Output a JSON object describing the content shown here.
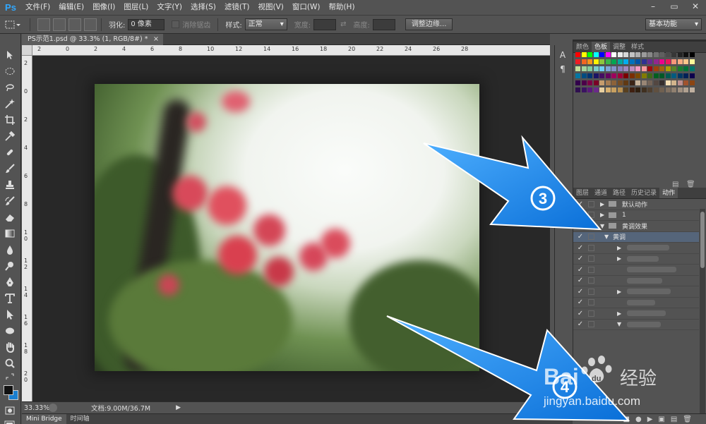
{
  "app": {
    "logo": "Ps"
  },
  "menu": [
    "文件(F)",
    "编辑(E)",
    "图像(I)",
    "图层(L)",
    "文字(Y)",
    "选择(S)",
    "滤镜(T)",
    "视图(V)",
    "窗口(W)",
    "帮助(H)"
  ],
  "window_controls": {
    "minimize": "–",
    "restore": "▭",
    "close": "✕"
  },
  "options": {
    "feather_label": "羽化:",
    "feather_value": "0 像素",
    "antialias_label": "消除锯齿",
    "style_label": "样式:",
    "style_value": "正常",
    "width_label": "宽度:",
    "height_label": "高度:",
    "refine_button": "调整边缘...",
    "workspace": "基本功能"
  },
  "document": {
    "tab_title": "PS示范1.psd @ 33.3% (1, RGB/8#) *",
    "close": "×"
  },
  "ruler": {
    "h_labels": [
      "2",
      "0",
      "2",
      "4",
      "6",
      "8",
      "10",
      "12",
      "14",
      "16",
      "18",
      "20",
      "22",
      "24",
      "26",
      "28"
    ],
    "v_labels": [
      "2",
      "0",
      "2",
      "4",
      "6",
      "8",
      "1 0",
      "1 2",
      "1 4",
      "1 6",
      "1 8",
      "2 0"
    ]
  },
  "status": {
    "zoom": "33.33%",
    "doc_size": "文档:9.00M/36.7M"
  },
  "bottom_tabs": [
    "Mini Bridge",
    "时间轴"
  ],
  "swatches_panel": {
    "tabs": [
      "颜色",
      "色板",
      "调整",
      "样式"
    ],
    "active": 1
  },
  "swatch_colors": [
    [
      "#ff0000",
      "#ffff00",
      "#00ff00",
      "#00ffff",
      "#0000ff",
      "#ff00ff",
      "#ffffff",
      "#ebebeb",
      "#d7d7d7",
      "#c3c3c3",
      "#afafaf",
      "#9b9b9b",
      "#878787",
      "#737373",
      "#5f5f5f",
      "#4b4b4b",
      "#373737",
      "#232323",
      "#0f0f0f",
      "#000000"
    ],
    [
      "#ee1c24",
      "#f26522",
      "#f7941d",
      "#fff200",
      "#8dc63f",
      "#39b54a",
      "#00a651",
      "#00a99d",
      "#00aeef",
      "#0072bc",
      "#0054a6",
      "#2e3192",
      "#662d91",
      "#92278f",
      "#ec008c",
      "#ed145b",
      "#f7977a",
      "#f9ad81",
      "#fdc68a",
      "#fff79a"
    ],
    [
      "#c4df9b",
      "#a3d39c",
      "#82ca9c",
      "#7accc8",
      "#6dcff6",
      "#7da7d9",
      "#8393ca",
      "#8781bd",
      "#a187be",
      "#bd8cbf",
      "#f49ac2",
      "#f6989d",
      "#9e0b0f",
      "#a0410d",
      "#a36209",
      "#aba000",
      "#598527",
      "#197b30",
      "#007236",
      "#00746b"
    ],
    [
      "#0076a3",
      "#004b80",
      "#003471",
      "#1b1464",
      "#440e62",
      "#630460",
      "#9e005d",
      "#9e0039",
      "#790000",
      "#7b2e00",
      "#7d4900",
      "#827b00",
      "#406618",
      "#005e20",
      "#005826",
      "#005952",
      "#005b7f",
      "#003663",
      "#002157",
      "#0d004c"
    ],
    [
      "#32004b",
      "#4b0049",
      "#7b0046",
      "#7a0026",
      "#c69c6d",
      "#a67c52",
      "#8c6239",
      "#754c24",
      "#603913",
      "#3c2415",
      "#c7b299",
      "#998675",
      "#736357",
      "#534741",
      "#362f2d",
      "#f5deb3",
      "#d2b48c",
      "#bc8f8f",
      "#a0522d",
      "#8b4513"
    ],
    [
      "#2f0f4f",
      "#3b1361",
      "#5a1a7a",
      "#6b2a8a",
      "#e8d0a0",
      "#d8b070",
      "#c8a060",
      "#b89050",
      "#584020",
      "#402010",
      "#302010",
      "#403020",
      "#504030",
      "#605040",
      "#706050",
      "#807060",
      "#908070",
      "#a09080",
      "#b0a090",
      "#c0b0a0"
    ]
  ],
  "actions_panel": {
    "tabs": [
      "图层",
      "通道",
      "路径",
      "历史记录",
      "动作"
    ],
    "active": 4,
    "rows": [
      {
        "check": "✓",
        "tri": "▶",
        "folder": true,
        "label": "默认动作",
        "selected": false
      },
      {
        "check": "✓",
        "tri": "▶",
        "folder": true,
        "label": "1",
        "selected": false
      },
      {
        "check": "✓",
        "tri": "▼",
        "folder": true,
        "label": "黄调效果",
        "selected": false
      },
      {
        "check": "✓",
        "tri": "▼",
        "folder": false,
        "label": "黄调",
        "selected": true
      },
      {
        "check": "✓",
        "tri": "▶",
        "folder": false,
        "label": "",
        "selected": false
      },
      {
        "check": "✓",
        "tri": "▶",
        "folder": false,
        "label": "",
        "selected": false
      },
      {
        "check": "✓",
        "tri": "",
        "folder": false,
        "label": "",
        "selected": false
      },
      {
        "check": "✓",
        "tri": "",
        "folder": false,
        "label": "",
        "selected": false
      },
      {
        "check": "✓",
        "tri": "▶",
        "folder": false,
        "label": "",
        "selected": false
      },
      {
        "check": "✓",
        "tri": "",
        "folder": false,
        "label": "",
        "selected": false
      },
      {
        "check": "✓",
        "tri": "▶",
        "folder": false,
        "label": "",
        "selected": false
      },
      {
        "check": "✓",
        "tri": "▼",
        "folder": false,
        "label": "",
        "selected": false
      }
    ]
  },
  "actions_footer": [
    "■",
    "●",
    "▶",
    "▣",
    "▤",
    "🗑"
  ],
  "annotations": {
    "step3": "3",
    "step4": "4",
    "arrow_color": "#1a8cff"
  },
  "watermark": {
    "brand": "Bai",
    "brand2": "du",
    "cn": "经验",
    "url": "jingyan.baidu.com"
  }
}
